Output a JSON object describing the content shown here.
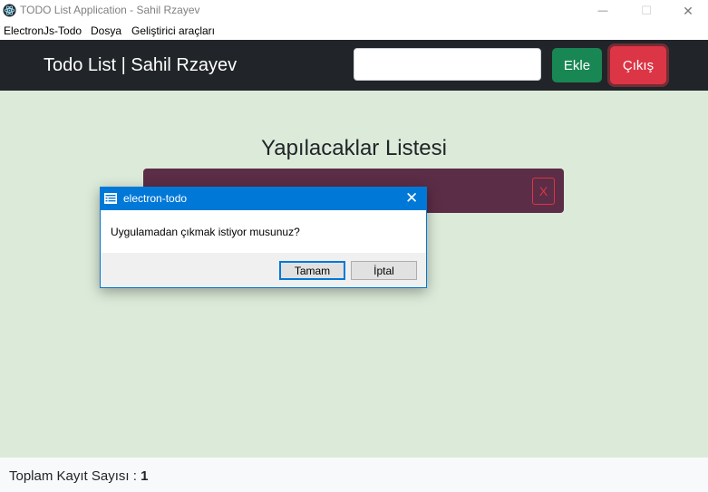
{
  "window": {
    "title": "TODO List Application - Sahil Rzayev",
    "icon": "electron-icon",
    "controls": {
      "minimize": "—",
      "maximize": "☐",
      "close": "✕"
    }
  },
  "menubar": {
    "items": [
      "ElectronJs-Todo",
      "Dosya",
      "Geliştirici araçları"
    ]
  },
  "navbar": {
    "brand": "Todo List | Sahil Rzayev",
    "input_value": "",
    "add_label": "Ekle",
    "exit_label": "Çıkış"
  },
  "main": {
    "list_title": "Yapılacaklar Listesi",
    "todos": [
      {
        "text": "",
        "delete_label": "X"
      }
    ]
  },
  "footer": {
    "label": "Toplam Kayıt Sayısı : ",
    "count": "1"
  },
  "dialog": {
    "title": "electron-todo",
    "message": "Uygulamadan çıkmak istiyor musunuz?",
    "ok_label": "Tamam",
    "cancel_label": "İptal",
    "close_glyph": "✕"
  },
  "colors": {
    "navbar_bg": "#212529",
    "main_bg": "#dcebd9",
    "todo_bg": "#5c2d46",
    "success": "#198754",
    "danger": "#dc3545",
    "dialog_accent": "#0078d7"
  }
}
